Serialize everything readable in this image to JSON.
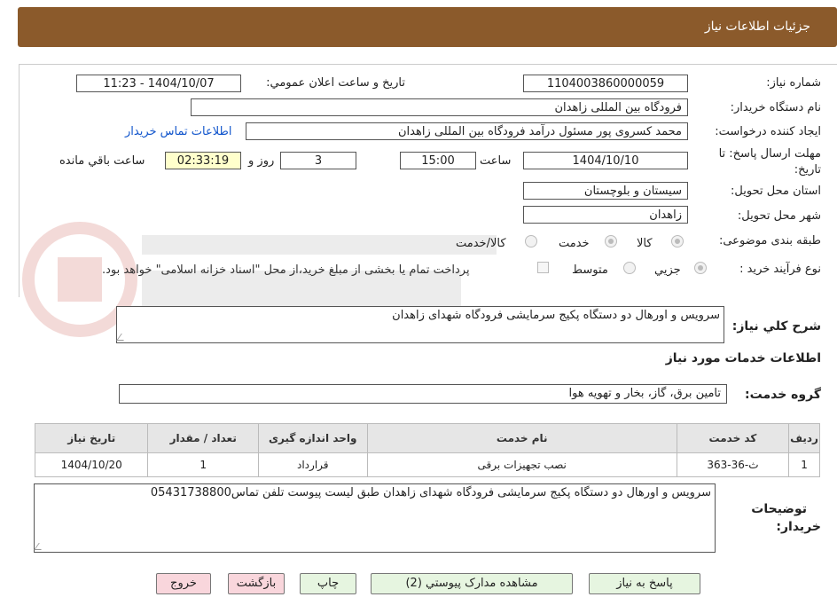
{
  "header": {
    "title": "جزئیات اطلاعات نیاز"
  },
  "form": {
    "need_number_label": "شماره نیاز:",
    "need_number": "1104003860000059",
    "announce_label": "تاریخ و ساعت اعلان عمومي:",
    "announce_value": "1404/10/07 - 11:23",
    "buyer_org_label": "نام دستگاه خریدار:",
    "buyer_org": "فرودگاه بین المللی زاهدان",
    "requester_label": "ایجاد کننده درخواست:",
    "requester": "محمد کسروی پور مسئول درآمد فرودگاه بین المللی زاهدان",
    "contact_link": "اطلاعات تماس خریدار",
    "deadline_label_line1": "مهلت ارسال پاسخ: تا",
    "deadline_label_line2": "تاریخ:",
    "deadline_date": "1404/10/10",
    "hour_label": "ساعت",
    "deadline_time": "15:00",
    "days_value": "3",
    "days_label": "روز و",
    "remaining_time": "02:33:19",
    "remaining_label": "ساعت باقي مانده",
    "province_label": "استان محل تحویل:",
    "province": "سیستان و بلوچستان",
    "city_label": "شهر محل تحویل:",
    "city": "زاهدان",
    "category_label": "طبقه بندی موضوعی:",
    "category_options": [
      "کالا",
      "خدمت",
      "کالا/خدمت"
    ],
    "process_label": "نوع فرآیند خرید :",
    "process_options": [
      "جزيي",
      "متوسط"
    ],
    "payment_note": "پرداخت تمام یا بخشی از مبلغ خرید،از محل \"اسناد خزانه اسلامی\" خواهد بود."
  },
  "summary": {
    "label": "شرح کلي نياز:",
    "text": "سرویس و اورهال دو دستگاه پکیج سرمایشی فرودگاه شهدای زاهدان"
  },
  "services": {
    "section_title": "اطلاعات خدمات مورد نیاز",
    "group_label": "گروه خدمت:",
    "group_value": "تامین برق، گاز، بخار و تهویه هوا"
  },
  "table": {
    "headers": [
      "ردیف",
      "کد خدمت",
      "نام خدمت",
      "واحد اندازه گیری",
      "تعداد / مقدار",
      "تاریخ نیاز"
    ],
    "rows": [
      [
        "1",
        "ث-36-363",
        "نصب تجهیزات برقی",
        "قرارداد",
        "1",
        "1404/10/20"
      ]
    ]
  },
  "buyer_notes": {
    "label_line1": "توضیحات",
    "label_line2": "خریدار:",
    "text": "سرویس و اورهال دو دستگاه پکیج سرمایشی فرودگاه شهدای زاهدان طبق لیست پیوست تلفن تماس05431738800"
  },
  "buttons": {
    "reply": "پاسخ به نیاز",
    "view_docs": "مشاهده مدارک پیوستي (2)",
    "print": "چاپ",
    "back": "بازگشت",
    "exit": "خروج"
  },
  "colors": {
    "header_bg": "#8b5a2b",
    "link": "#1155cc",
    "timer_bg": "#ffffcc",
    "button_green": "#e6f5e0",
    "button_pink": "#f9d6dc"
  }
}
